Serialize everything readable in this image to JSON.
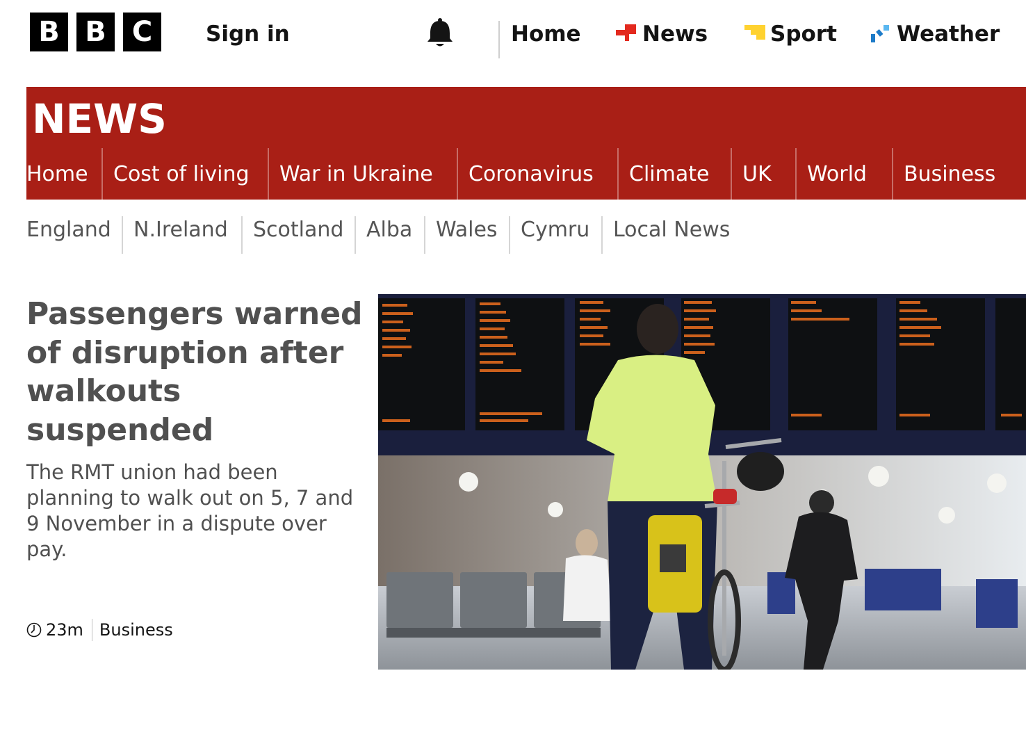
{
  "masthead": {
    "logo_letters": [
      "B",
      "B",
      "C"
    ],
    "sign_in": "Sign in",
    "notifications_icon": "bell-icon",
    "nav": [
      {
        "label": "Home",
        "icon": null
      },
      {
        "label": "News",
        "icon": "news-icon",
        "icon_color": "#e3291e"
      },
      {
        "label": "Sport",
        "icon": "sport-icon",
        "icon_color": "#ffd230"
      },
      {
        "label": "Weather",
        "icon": "weather-icon",
        "icon_color": "#1d7bc8"
      }
    ]
  },
  "news_section": {
    "wordmark": "NEWS",
    "brand_color": "#a91f16",
    "tabs": [
      "Home",
      "Cost of living",
      "War in Ukraine",
      "Coronavirus",
      "Climate",
      "UK",
      "World",
      "Business"
    ]
  },
  "sub_nav": [
    "England",
    "N.Ireland",
    "Scotland",
    "Alba",
    "Wales",
    "Cymru",
    "Local News"
  ],
  "lead_story": {
    "headline": "Passengers warned of disruption after walkouts suspended",
    "summary": "The RMT union had been planning to walk out on 5, 7 and 9 November in a dispute over pay.",
    "time_icon": "clock-icon",
    "time": "23m",
    "topic": "Business",
    "image": "photo: cyclist in a yellow jacket with a bicycle looking at departure boards in a railway station"
  }
}
